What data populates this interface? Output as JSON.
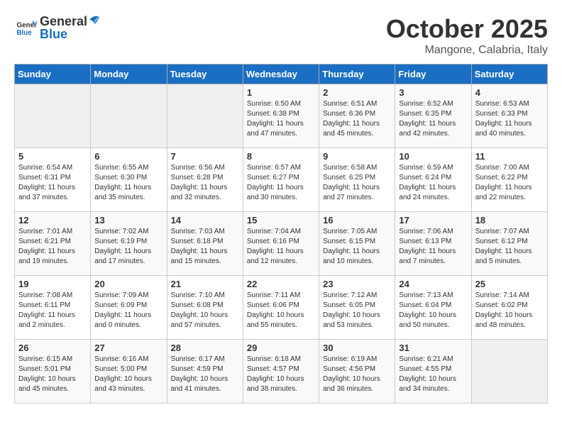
{
  "logo": {
    "text_general": "General",
    "text_blue": "Blue"
  },
  "title": {
    "month_year": "October 2025",
    "location": "Mangone, Calabria, Italy"
  },
  "weekdays": [
    "Sunday",
    "Monday",
    "Tuesday",
    "Wednesday",
    "Thursday",
    "Friday",
    "Saturday"
  ],
  "weeks": [
    [
      {
        "day": "",
        "info": ""
      },
      {
        "day": "",
        "info": ""
      },
      {
        "day": "",
        "info": ""
      },
      {
        "day": "1",
        "info": "Sunrise: 6:50 AM\nSunset: 6:38 PM\nDaylight: 11 hours\nand 47 minutes."
      },
      {
        "day": "2",
        "info": "Sunrise: 6:51 AM\nSunset: 6:36 PM\nDaylight: 11 hours\nand 45 minutes."
      },
      {
        "day": "3",
        "info": "Sunrise: 6:52 AM\nSunset: 6:35 PM\nDaylight: 11 hours\nand 42 minutes."
      },
      {
        "day": "4",
        "info": "Sunrise: 6:53 AM\nSunset: 6:33 PM\nDaylight: 11 hours\nand 40 minutes."
      }
    ],
    [
      {
        "day": "5",
        "info": "Sunrise: 6:54 AM\nSunset: 6:31 PM\nDaylight: 11 hours\nand 37 minutes."
      },
      {
        "day": "6",
        "info": "Sunrise: 6:55 AM\nSunset: 6:30 PM\nDaylight: 11 hours\nand 35 minutes."
      },
      {
        "day": "7",
        "info": "Sunrise: 6:56 AM\nSunset: 6:28 PM\nDaylight: 11 hours\nand 32 minutes."
      },
      {
        "day": "8",
        "info": "Sunrise: 6:57 AM\nSunset: 6:27 PM\nDaylight: 11 hours\nand 30 minutes."
      },
      {
        "day": "9",
        "info": "Sunrise: 6:58 AM\nSunset: 6:25 PM\nDaylight: 11 hours\nand 27 minutes."
      },
      {
        "day": "10",
        "info": "Sunrise: 6:59 AM\nSunset: 6:24 PM\nDaylight: 11 hours\nand 24 minutes."
      },
      {
        "day": "11",
        "info": "Sunrise: 7:00 AM\nSunset: 6:22 PM\nDaylight: 11 hours\nand 22 minutes."
      }
    ],
    [
      {
        "day": "12",
        "info": "Sunrise: 7:01 AM\nSunset: 6:21 PM\nDaylight: 11 hours\nand 19 minutes."
      },
      {
        "day": "13",
        "info": "Sunrise: 7:02 AM\nSunset: 6:19 PM\nDaylight: 11 hours\nand 17 minutes."
      },
      {
        "day": "14",
        "info": "Sunrise: 7:03 AM\nSunset: 6:18 PM\nDaylight: 11 hours\nand 15 minutes."
      },
      {
        "day": "15",
        "info": "Sunrise: 7:04 AM\nSunset: 6:16 PM\nDaylight: 11 hours\nand 12 minutes."
      },
      {
        "day": "16",
        "info": "Sunrise: 7:05 AM\nSunset: 6:15 PM\nDaylight: 11 hours\nand 10 minutes."
      },
      {
        "day": "17",
        "info": "Sunrise: 7:06 AM\nSunset: 6:13 PM\nDaylight: 11 hours\nand 7 minutes."
      },
      {
        "day": "18",
        "info": "Sunrise: 7:07 AM\nSunset: 6:12 PM\nDaylight: 11 hours\nand 5 minutes."
      }
    ],
    [
      {
        "day": "19",
        "info": "Sunrise: 7:08 AM\nSunset: 6:11 PM\nDaylight: 11 hours\nand 2 minutes."
      },
      {
        "day": "20",
        "info": "Sunrise: 7:09 AM\nSunset: 6:09 PM\nDaylight: 11 hours\nand 0 minutes."
      },
      {
        "day": "21",
        "info": "Sunrise: 7:10 AM\nSunset: 6:08 PM\nDaylight: 10 hours\nand 57 minutes."
      },
      {
        "day": "22",
        "info": "Sunrise: 7:11 AM\nSunset: 6:06 PM\nDaylight: 10 hours\nand 55 minutes."
      },
      {
        "day": "23",
        "info": "Sunrise: 7:12 AM\nSunset: 6:05 PM\nDaylight: 10 hours\nand 53 minutes."
      },
      {
        "day": "24",
        "info": "Sunrise: 7:13 AM\nSunset: 6:04 PM\nDaylight: 10 hours\nand 50 minutes."
      },
      {
        "day": "25",
        "info": "Sunrise: 7:14 AM\nSunset: 6:02 PM\nDaylight: 10 hours\nand 48 minutes."
      }
    ],
    [
      {
        "day": "26",
        "info": "Sunrise: 6:15 AM\nSunset: 5:01 PM\nDaylight: 10 hours\nand 45 minutes."
      },
      {
        "day": "27",
        "info": "Sunrise: 6:16 AM\nSunset: 5:00 PM\nDaylight: 10 hours\nand 43 minutes."
      },
      {
        "day": "28",
        "info": "Sunrise: 6:17 AM\nSunset: 4:59 PM\nDaylight: 10 hours\nand 41 minutes."
      },
      {
        "day": "29",
        "info": "Sunrise: 6:18 AM\nSunset: 4:57 PM\nDaylight: 10 hours\nand 38 minutes."
      },
      {
        "day": "30",
        "info": "Sunrise: 6:19 AM\nSunset: 4:56 PM\nDaylight: 10 hours\nand 36 minutes."
      },
      {
        "day": "31",
        "info": "Sunrise: 6:21 AM\nSunset: 4:55 PM\nDaylight: 10 hours\nand 34 minutes."
      },
      {
        "day": "",
        "info": ""
      }
    ]
  ]
}
